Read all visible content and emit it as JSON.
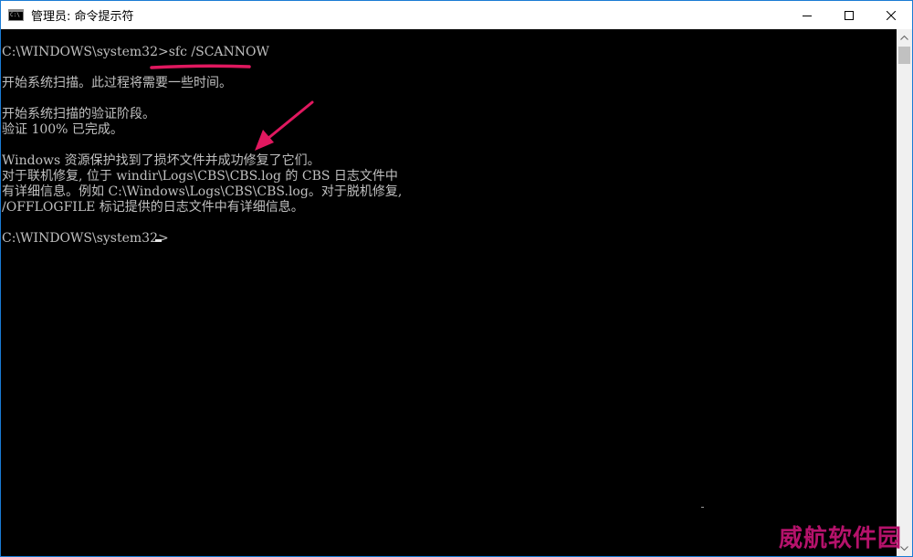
{
  "window": {
    "title": "管理员: 命令提示符"
  },
  "console": {
    "lines": [
      "C:\\WINDOWS\\system32>sfc /SCANNOW",
      "开始系统扫描。此过程将需要一些时间。",
      "开始系统扫描的验证阶段。",
      "验证 100% 已完成。",
      "Windows 资源保护找到了损坏文件并成功修复了它们。",
      "对于联机修复, 位于 windir\\Logs\\CBS\\CBS.log 的 CBS 日志文件中",
      "有详细信息。例如 C:\\Windows\\Logs\\CBS\\CBS.log。对于脱机修复,",
      "/OFFLOGFILE 标记提供的日志文件中有详细信息。",
      "C:\\WINDOWS\\system32>"
    ]
  },
  "annotation": {
    "color": "#e0185f",
    "watermark": "威航软件园"
  },
  "icons": {
    "app": "cmd-icon",
    "minimize": "minimize-icon",
    "maximize": "maximize-icon",
    "close": "close-icon"
  }
}
